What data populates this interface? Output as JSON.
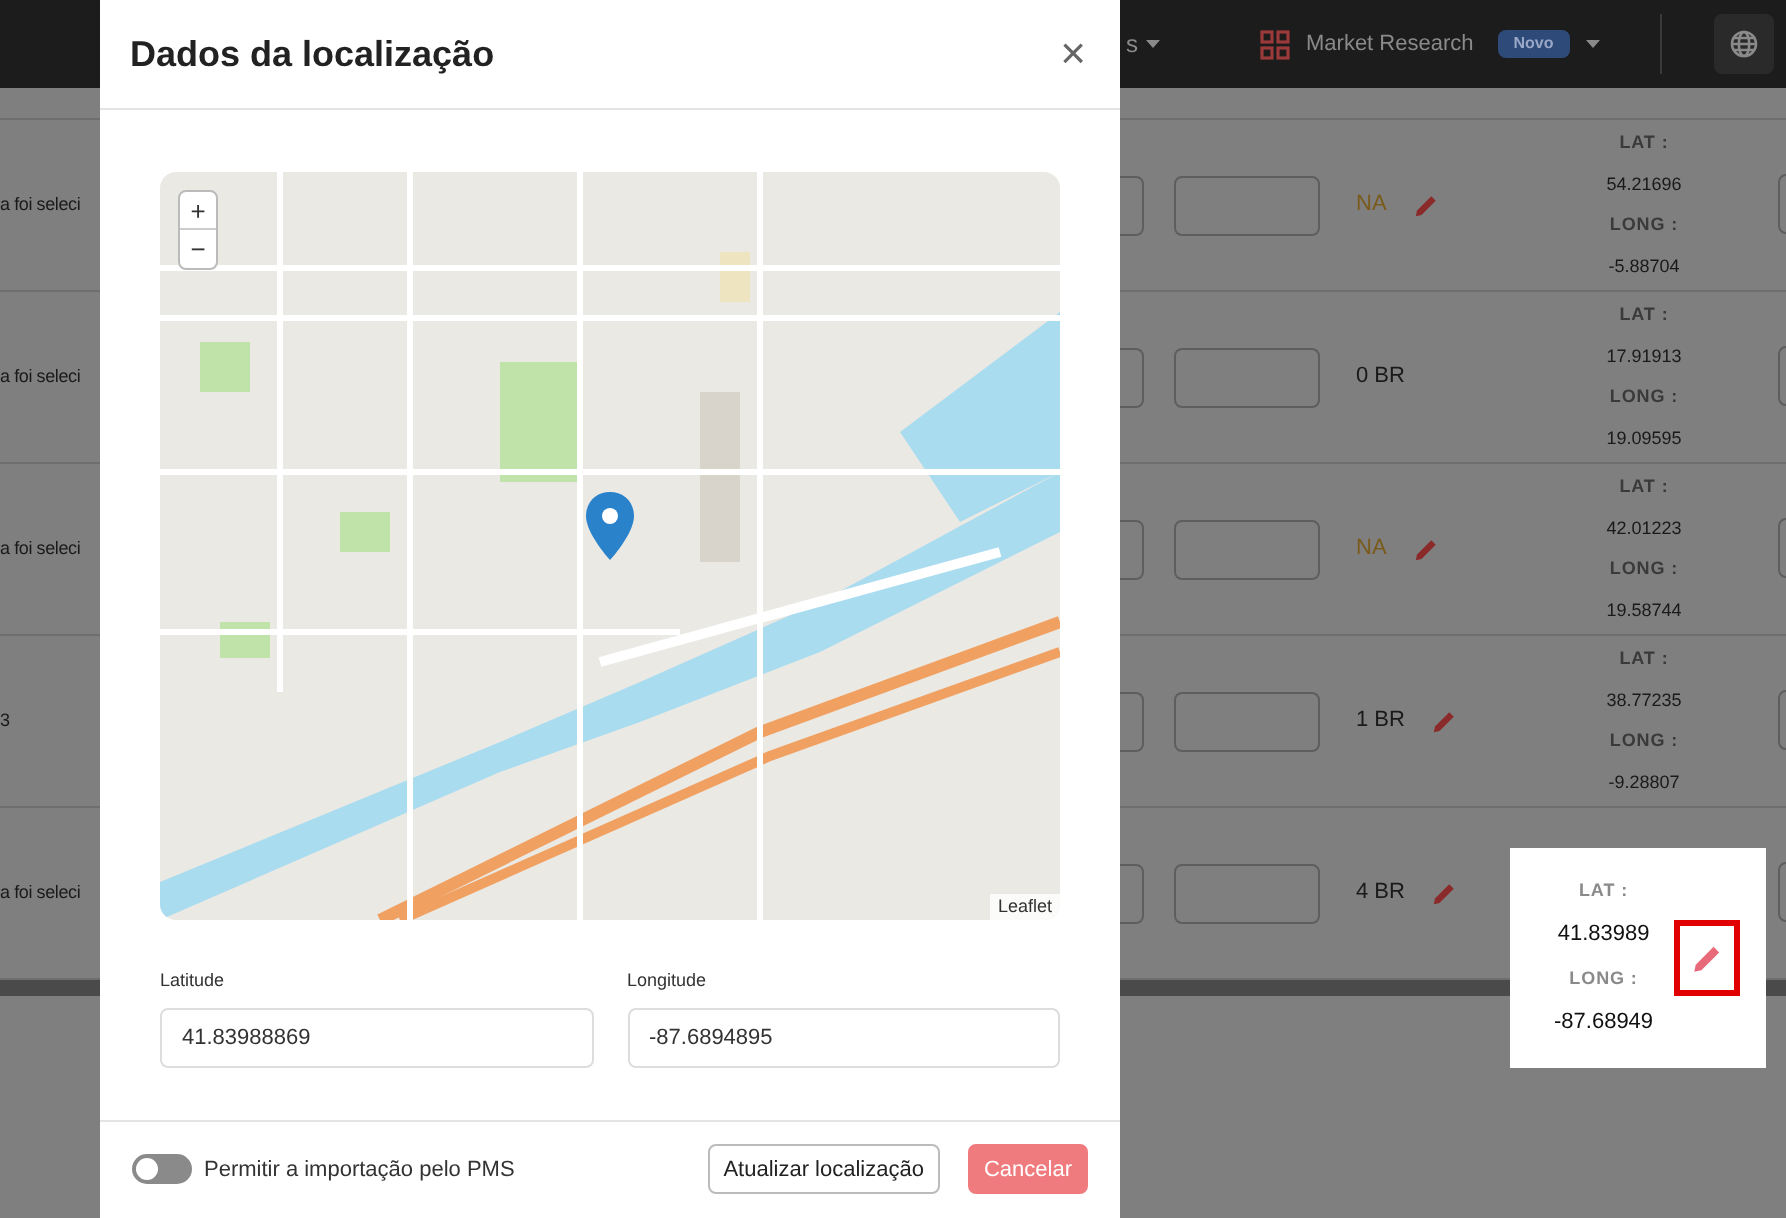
{
  "header": {
    "nav_partial": "s",
    "product": "Market Research",
    "badge": "Novo"
  },
  "rows": [
    {
      "text": "a foi seleci",
      "status": "NA",
      "color": "#7a5a1a",
      "editable": true,
      "lat_label": "LAT :",
      "lat": "54.21696",
      "long_label": "LONG :",
      "long": "-5.88704",
      "highlighted": false
    },
    {
      "text": "a foi seleci",
      "status": "0 BR",
      "color": "#1a1a1a",
      "editable": false,
      "lat_label": "LAT :",
      "lat": "17.91913",
      "long_label": "LONG :",
      "long": "19.09595",
      "highlighted": false
    },
    {
      "text": "a foi seleci",
      "status": "NA",
      "color": "#7a5a1a",
      "editable": true,
      "lat_label": "LAT :",
      "lat": "42.01223",
      "long_label": "LONG :",
      "long": "19.58744",
      "highlighted": false
    },
    {
      "text": "3",
      "status": "1 BR",
      "color": "#1a1a1a",
      "editable": true,
      "lat_label": "LAT :",
      "lat": "38.77235",
      "long_label": "LONG :",
      "long": "-9.28807",
      "highlighted": false
    },
    {
      "text": "a foi seleci",
      "status": "4 BR",
      "color": "#1a1a1a",
      "editable": true,
      "lat_label": "LAT :",
      "lat": "41.83989",
      "long_label": "LONG :",
      "long": "-87.68949",
      "highlighted": true
    }
  ],
  "modal": {
    "title": "Dados da localização",
    "close": "×",
    "map": {
      "zoom_in": "+",
      "zoom_out": "−",
      "attribution": "Leaflet"
    },
    "fields": [
      {
        "label": "Latitude",
        "value": "41.83988869"
      },
      {
        "label": "Longitude",
        "value": "-87.6894895"
      }
    ],
    "toggle": {
      "label": "Permitir a importação pelo PMS",
      "on": false
    },
    "buttons": [
      {
        "label": "Atualizar localização",
        "kind": "secondary"
      },
      {
        "label": "Cancelar",
        "kind": "danger"
      }
    ]
  }
}
